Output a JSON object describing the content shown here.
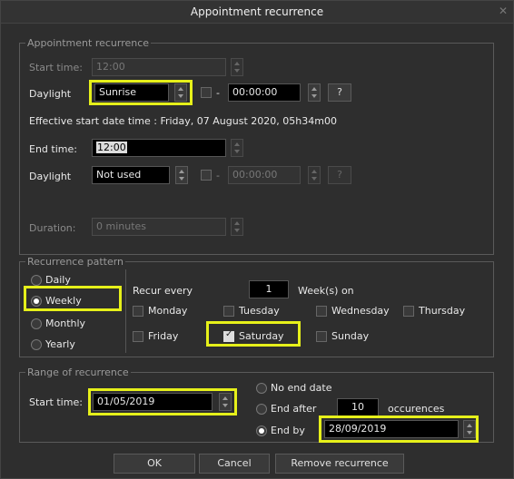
{
  "window": {
    "title": "Appointment recurrence",
    "close_icon": "close-icon"
  },
  "appointment": {
    "legend": "Appointment recurrence",
    "start_time_label": "Start time:",
    "start_time_value": "12:00",
    "daylight_label": "Daylight",
    "daylight_value": "Sunrise",
    "offset_sign": "-",
    "offset_value": "00:00:00",
    "help_label": "?",
    "effective_text": "Effective start date time : Friday, 07 August 2020, 05h34m00",
    "end_time_label": "End time:",
    "end_time_value": "12:00",
    "daylight2_label": "Daylight",
    "daylight2_value": "Not used",
    "offset2_sign": "-",
    "offset2_value": "00:00:00",
    "help2_label": "?",
    "duration_label": "Duration:",
    "duration_value": "0 minutes"
  },
  "pattern": {
    "legend": "Recurrence pattern",
    "options": {
      "daily": "Daily",
      "weekly": "Weekly",
      "monthly": "Monthly",
      "yearly": "Yearly"
    },
    "selected": "weekly",
    "recur_every_label": "Recur every",
    "recur_every_value": "1",
    "weeks_on_label": "Week(s) on",
    "days": {
      "monday": "Monday",
      "tuesday": "Tuesday",
      "wednesday": "Wednesday",
      "thursday": "Thursday",
      "friday": "Friday",
      "saturday": "Saturday",
      "sunday": "Sunday"
    },
    "checked_days": [
      "saturday"
    ]
  },
  "range": {
    "legend": "Range of recurrence",
    "start_label": "Start time:",
    "start_value": "01/05/2019",
    "no_end_label": "No end date",
    "end_after_label": "End after",
    "end_after_value": "10",
    "occurrences_label": "occurences",
    "end_by_label": "End by",
    "end_by_value": "28/09/2019",
    "selected": "end_by"
  },
  "buttons": {
    "ok": "OK",
    "cancel": "Cancel",
    "remove": "Remove recurrence"
  },
  "colors": {
    "highlight": "#e6f01a",
    "background": "#2e2e2e"
  }
}
